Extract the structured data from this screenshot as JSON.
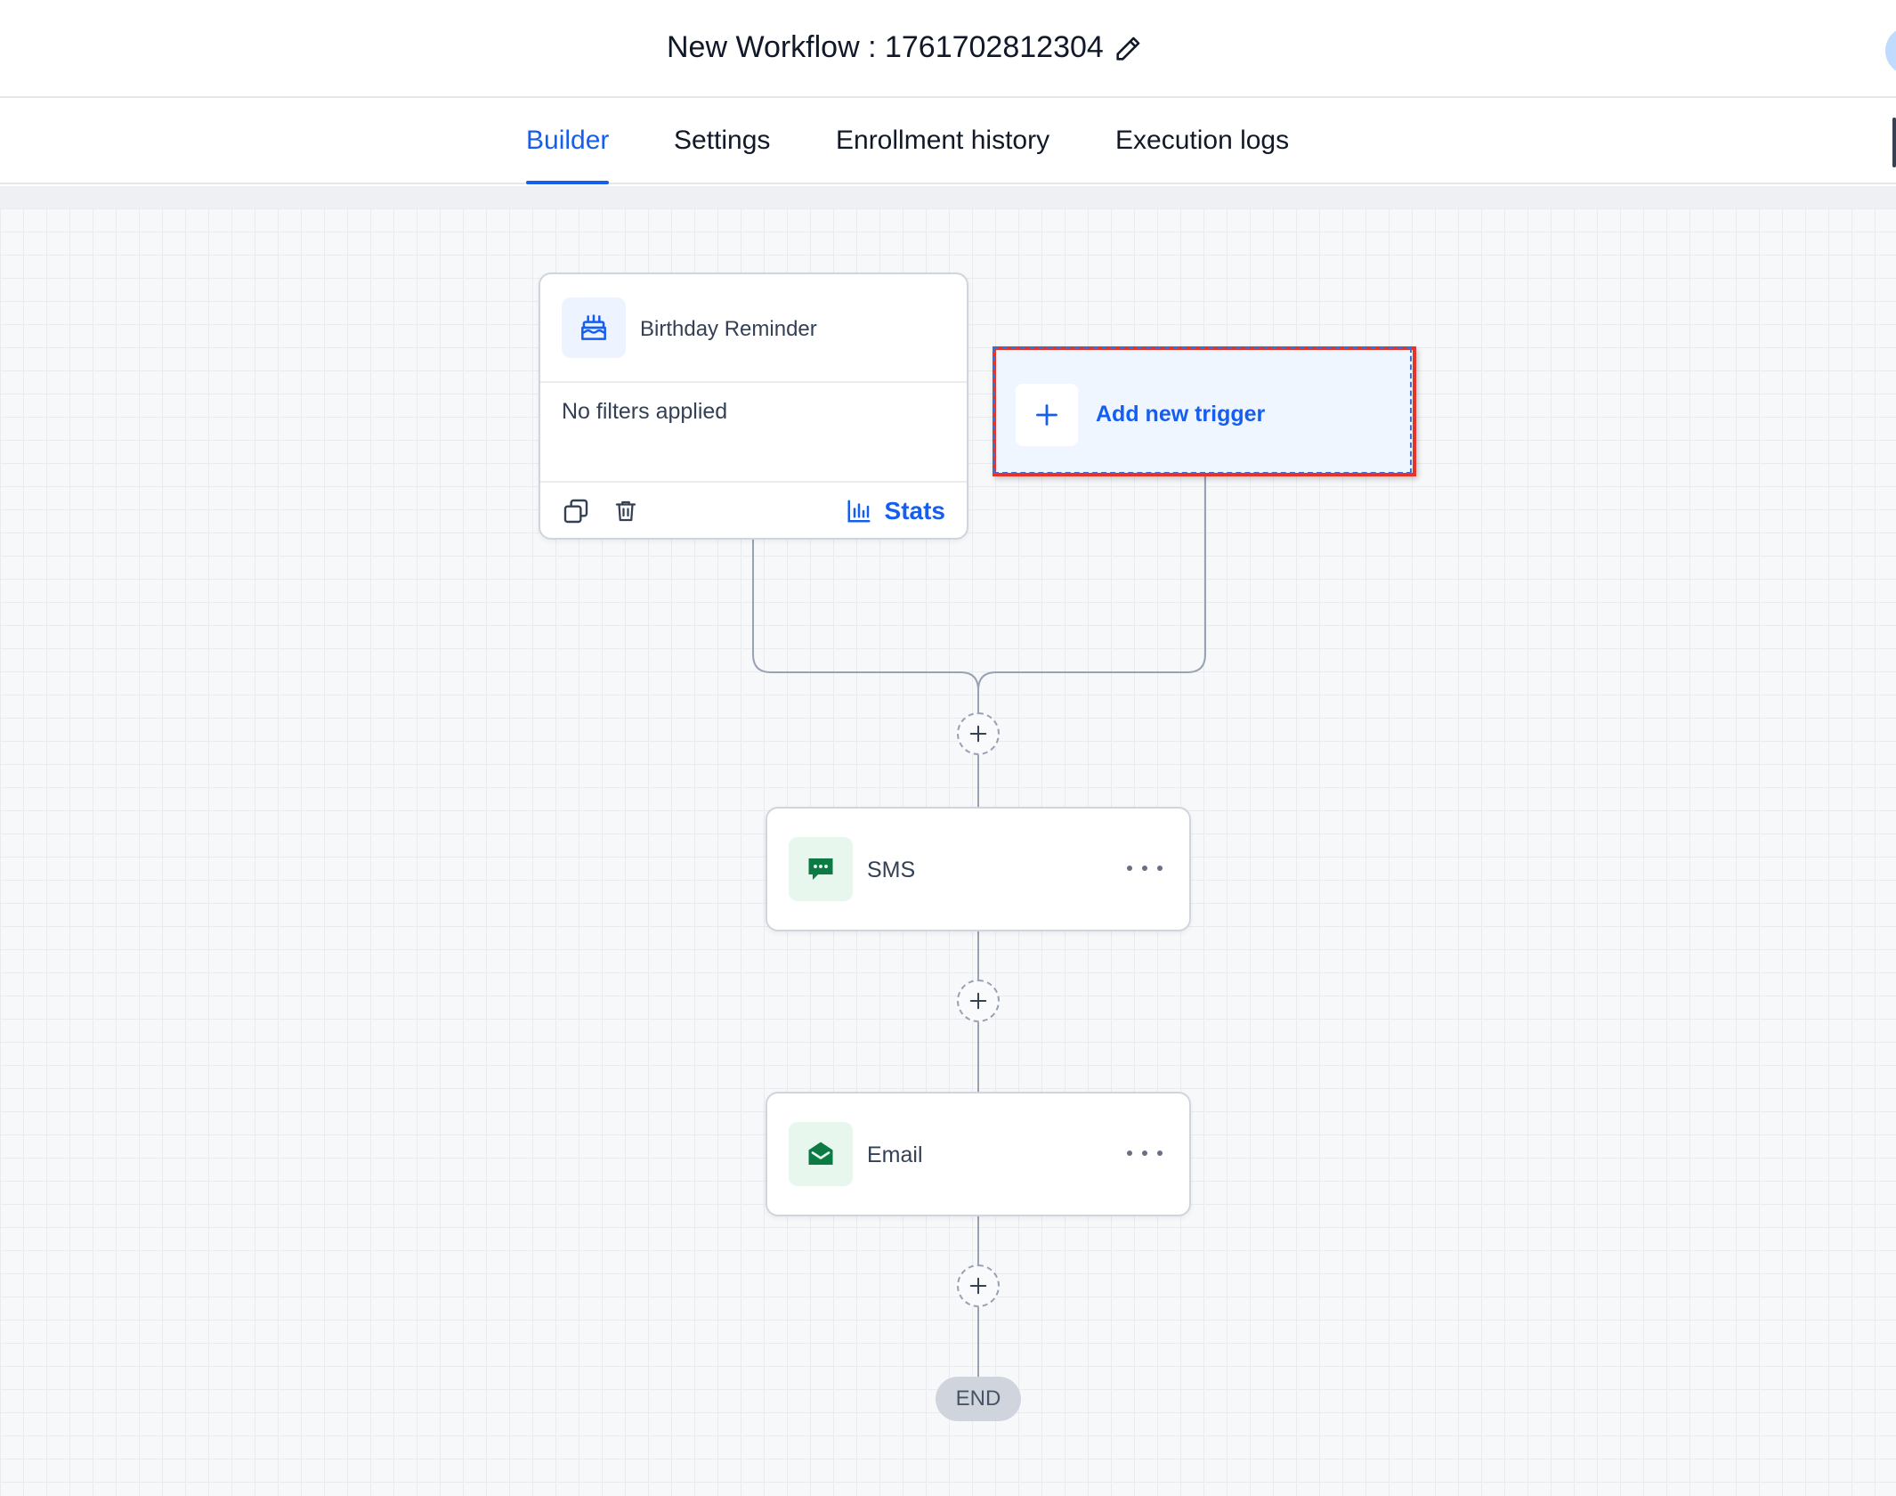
{
  "header": {
    "workflow_title": "New Workflow : 1761702812304"
  },
  "tabs": [
    {
      "label": "Builder",
      "active": true
    },
    {
      "label": "Settings",
      "active": false
    },
    {
      "label": "Enrollment history",
      "active": false
    },
    {
      "label": "Execution logs",
      "active": false
    }
  ],
  "trigger": {
    "name": "Birthday Reminder",
    "filters": "No filters applied",
    "stats_label": "Stats",
    "icon": "cake-icon"
  },
  "add_trigger": {
    "label": "Add new trigger"
  },
  "actions": [
    {
      "label": "SMS",
      "icon": "chat-bubble-icon"
    },
    {
      "label": "Email",
      "icon": "envelope-icon"
    }
  ],
  "end_label": "END",
  "colors": {
    "accent": "#155eef",
    "highlight_border": "#e5332a",
    "action_icon": "#0b7a43"
  }
}
